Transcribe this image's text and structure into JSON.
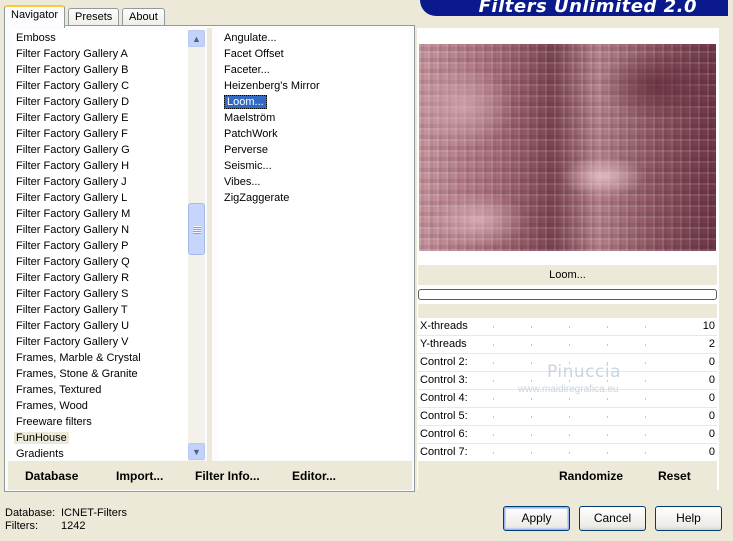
{
  "app": {
    "title": "Filters Unlimited 2.0"
  },
  "tabs": [
    {
      "label": "Navigator",
      "active": true
    },
    {
      "label": "Presets",
      "active": false
    },
    {
      "label": "About",
      "active": false
    }
  ],
  "categories": {
    "items": [
      "Emboss",
      "Filter Factory Gallery A",
      "Filter Factory Gallery B",
      "Filter Factory Gallery C",
      "Filter Factory Gallery D",
      "Filter Factory Gallery E",
      "Filter Factory Gallery F",
      "Filter Factory Gallery G",
      "Filter Factory Gallery H",
      "Filter Factory Gallery J",
      "Filter Factory Gallery L",
      "Filter Factory Gallery M",
      "Filter Factory Gallery N",
      "Filter Factory Gallery P",
      "Filter Factory Gallery Q",
      "Filter Factory Gallery R",
      "Filter Factory Gallery S",
      "Filter Factory Gallery T",
      "Filter Factory Gallery U",
      "Filter Factory Gallery V",
      "Frames, Marble & Crystal",
      "Frames, Stone & Granite",
      "Frames, Textured",
      "Frames, Wood",
      "Freeware filters",
      "FunHouse",
      "Gradients"
    ],
    "selected": "FunHouse"
  },
  "filters": {
    "items": [
      "Angulate...",
      "Facet Offset",
      "Faceter...",
      "Heizenberg's Mirror",
      "Loom...",
      "Maelström",
      "PatchWork",
      "Perverse",
      "Seismic...",
      "Vibes...",
      "ZigZaggerate"
    ],
    "selected": "Loom..."
  },
  "bottom_buttons": {
    "database": "Database",
    "import": "Import...",
    "filter_info": "Filter Info...",
    "editor": "Editor..."
  },
  "preview": {
    "filter_name": "Loom..."
  },
  "controls": [
    {
      "label": "X-threads",
      "value": "10"
    },
    {
      "label": "Y-threads",
      "value": "2"
    },
    {
      "label": "Control 2:",
      "value": "0"
    },
    {
      "label": "Control 3:",
      "value": "0"
    },
    {
      "label": "Control 4:",
      "value": "0"
    },
    {
      "label": "Control 5:",
      "value": "0"
    },
    {
      "label": "Control 6:",
      "value": "0"
    },
    {
      "label": "Control 7:",
      "value": "0"
    }
  ],
  "watermark": {
    "name": "Pinuccia",
    "url": "www.maidiregrafica.eu"
  },
  "actions": {
    "randomize": "Randomize",
    "reset": "Reset"
  },
  "footer": {
    "database_label": "Database:",
    "database_value": "ICNET-Filters",
    "filters_label": "Filters:",
    "filters_value": "1242"
  },
  "dialog_buttons": {
    "apply": "Apply",
    "cancel": "Cancel",
    "help": "Help"
  },
  "colors": {
    "selection": "#316ac5",
    "banner": "#0a1a8c",
    "dialog_bg": "#ece9d8"
  }
}
